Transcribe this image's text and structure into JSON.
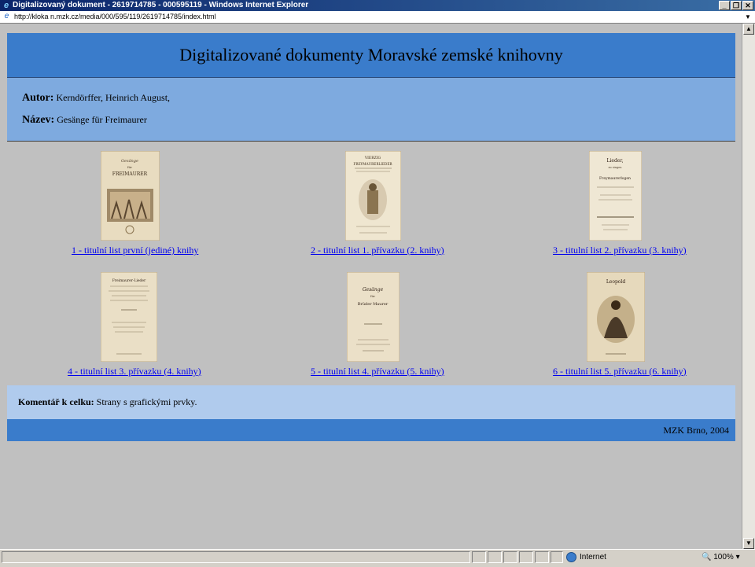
{
  "window": {
    "title": "Digitalizovaný dokument - 2619714785 - 000595119 - Windows Internet Explorer",
    "minimize_glyph": "_",
    "restore_glyph": "❐",
    "close_glyph": "✕"
  },
  "address": {
    "url": "http://kloka n.mzk.cz/media/000/595/119/2619714785/index.html"
  },
  "page": {
    "heading": "Digitalizované dokumenty Moravské zemské knihovny",
    "author_label": "Autor:",
    "author_value": "Kerndörffer, Heinrich August,",
    "title_label": "Název:",
    "title_value": "Gesänge für Freimaurer",
    "thumbnails": [
      {
        "label": "1 -  titulní list první (jediné) knihy",
        "caption": "FREIMAURER"
      },
      {
        "label": "2 -  titulní list 1. přívazku (2. knihy)",
        "caption": "FREYMAURERLIEDER"
      },
      {
        "label": "3 -  titulní list 2. přívazku (3. knihy)",
        "caption": "Freymaurerlogen"
      },
      {
        "label": "4 -  titulní list 3. přívazku (4. knihy)",
        "caption": "Freimaurer-Lieder"
      },
      {
        "label": "5 -  titulní list 4. přívazku (5. knihy)",
        "caption": "Brüder Maurer"
      },
      {
        "label": "6 -  titulní list 5. přívazku (6. knihy)",
        "caption": "Leopold"
      }
    ],
    "comment_label": "Komentář k celku:",
    "comment_value": "Strany s grafickými prvky.",
    "footer": "MZK Brno, 2004"
  },
  "status": {
    "zone": "Internet",
    "zoom": "100%"
  },
  "colors": {
    "header_blue": "#3a7ccb",
    "meta_blue": "#7eaadf",
    "comment_blue": "#b0cbed",
    "page_bg": "#c0c0c0",
    "link": "#0000ee"
  }
}
